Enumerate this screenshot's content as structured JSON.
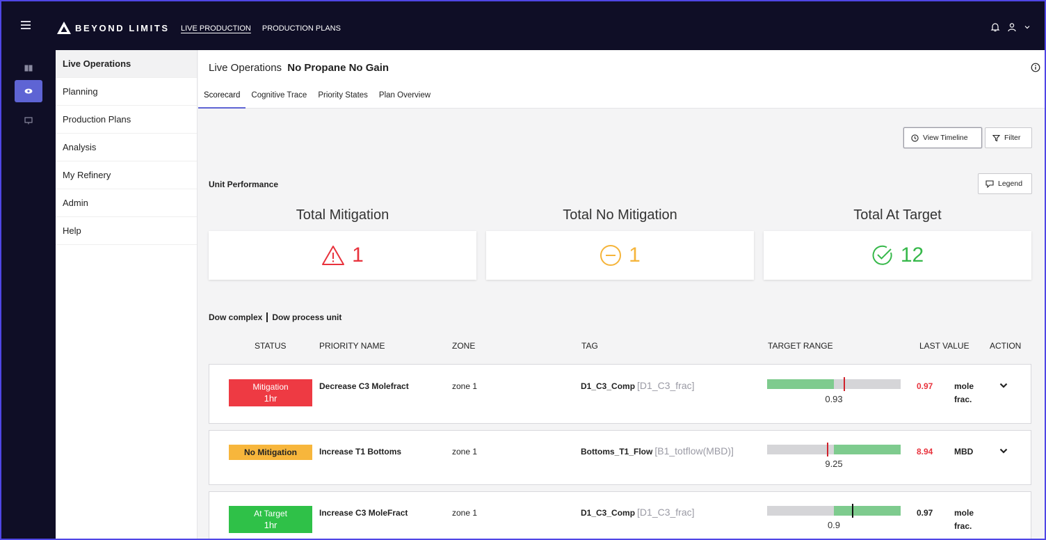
{
  "brand": {
    "name": "BEYOND LIMITS"
  },
  "topnav": [
    {
      "label": "LIVE PRODUCTION",
      "active": true
    },
    {
      "label": "PRODUCTION PLANS",
      "active": false
    }
  ],
  "sidebar": {
    "items": [
      {
        "label": "Live Operations",
        "active": true
      },
      {
        "label": "Planning"
      },
      {
        "label": "Production Plans"
      },
      {
        "label": "Analysis"
      },
      {
        "label": "My Refinery"
      },
      {
        "label": "Admin"
      },
      {
        "label": "Help"
      }
    ]
  },
  "header": {
    "title": "Live Operations",
    "subtitle": "No Propane No Gain"
  },
  "tabs": [
    {
      "label": "Scorecard",
      "active": true
    },
    {
      "label": "Cognitive Trace"
    },
    {
      "label": "Priority States"
    },
    {
      "label": "Plan Overview"
    }
  ],
  "toolbar": {
    "view_timeline": "View Timeline",
    "filter": "Filter",
    "legend": "Legend"
  },
  "unit_performance": {
    "label": "Unit Performance",
    "metrics": [
      {
        "title": "Total Mitigation",
        "value": "1",
        "color": "#e8323c",
        "icon": "warning-triangle-icon"
      },
      {
        "title": "Total No Mitigation",
        "value": "1",
        "color": "#f5b43a",
        "icon": "minus-circle-icon"
      },
      {
        "title": "Total At Target",
        "value": "12",
        "color": "#36b84a",
        "icon": "check-circle-icon"
      }
    ]
  },
  "breadcrumb": {
    "complex": "Dow complex",
    "unit": "Dow process unit"
  },
  "table": {
    "columns": [
      "STATUS",
      "PRIORITY NAME",
      "ZONE",
      "TAG",
      "TARGET RANGE",
      "LAST VALUE",
      "ACTION"
    ],
    "rows": [
      {
        "status": "Mitigation",
        "status_sub": "1hr",
        "status_color": "#ee3a43",
        "priority": "Decrease C3 Molefract",
        "zone": "zone 1",
        "tag": "D1_C3_Comp",
        "tag_alias": "[D1_C3_frac]",
        "range_value": "0.93",
        "last_value": "0.97",
        "last_color": "#e8323c",
        "unit": "mole frac."
      },
      {
        "status": "No Mitigation",
        "status_sub": "",
        "status_color": "#f7b63c",
        "priority": "Increase T1 Bottoms",
        "zone": "zone 1",
        "tag": "Bottoms_T1_Flow",
        "tag_alias": "[B1_totflow(MBD)]",
        "range_value": "9.25",
        "last_value": "8.94",
        "last_color": "#e8323c",
        "unit": "MBD"
      },
      {
        "status": "At Target",
        "status_sub": "1hr",
        "status_color": "#2fc148",
        "priority": "Increase C3 MoleFract",
        "zone": "zone 1",
        "tag": "D1_C3_Comp",
        "tag_alias": "[D1_C3_frac]",
        "range_value": "0.9",
        "last_value": "0.97",
        "last_color": "#222222",
        "unit": "mole frac."
      }
    ]
  },
  "colors": {
    "accent": "#5e64d4",
    "nav_bg": "#0f0e26",
    "mitigation": "#ee3a43",
    "no_mitigation": "#f7b63c",
    "at_target": "#2fc148",
    "range_band": "#7ecb8e"
  }
}
